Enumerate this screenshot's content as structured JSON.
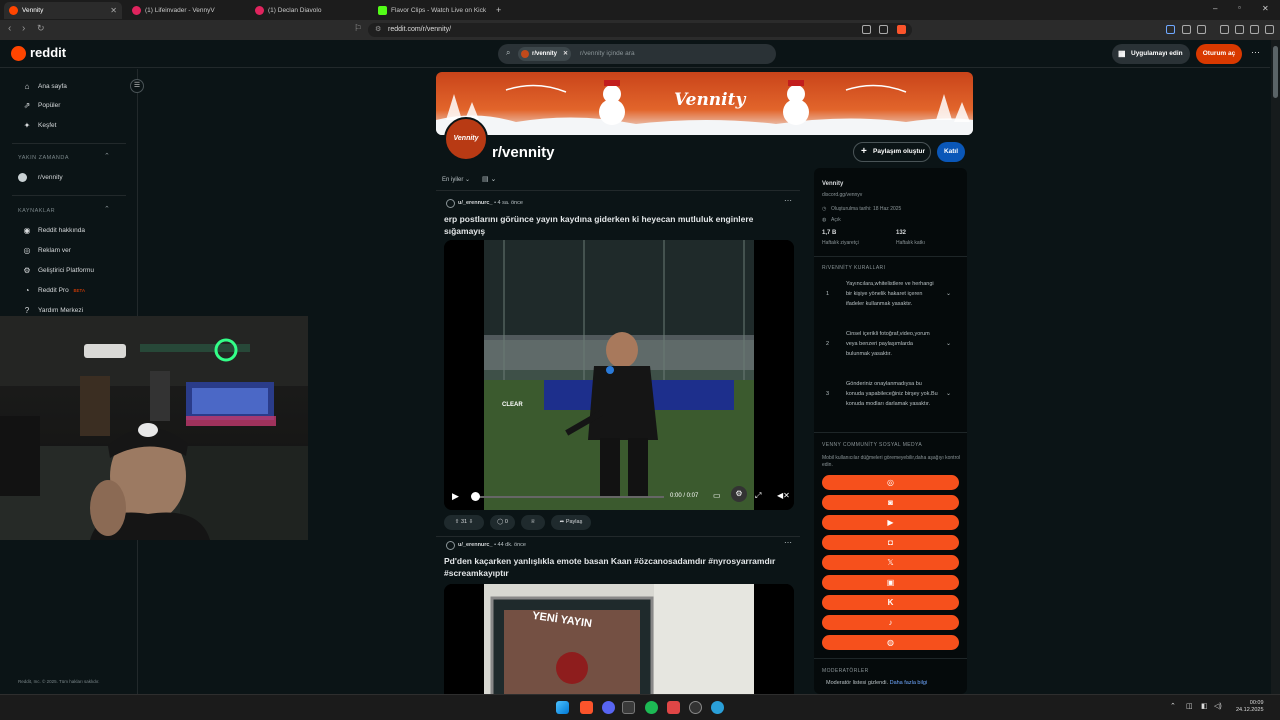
{
  "browser": {
    "tabs": [
      {
        "title": "Vennity",
        "color": "#ff4500"
      },
      {
        "title": "(1) Lifeinvader - VennyV",
        "color": "#e0245e"
      },
      {
        "title": "(1) Declan Diavolo",
        "color": "#e0245e"
      },
      {
        "title": "Flavor Clips - Watch Live on Kick",
        "color": "#53fc18"
      }
    ],
    "new_tab": "+",
    "url": "reddit.com/r/vennity/",
    "window_controls": [
      "–",
      "▫",
      "✕"
    ]
  },
  "header": {
    "logo_text": "reddit",
    "search_chip": "r/vennity",
    "search_placeholder": "r/vennity içinde ara",
    "get_app": "Uygulamayı edin",
    "login": "Oturum aç",
    "more": "⋯"
  },
  "sidebar": {
    "items": [
      {
        "label": "Ana sayfa",
        "icon": "⌂"
      },
      {
        "label": "Popüler",
        "icon": "⇗"
      },
      {
        "label": "Keşfet",
        "icon": "✦"
      }
    ],
    "recent_header": "YAKIN ZAMANDA",
    "recent": [
      {
        "label": "r/vennity"
      }
    ],
    "resources_header": "KAYNAKLAR",
    "resources": [
      {
        "label": "Reddit hakkında",
        "icon": "◉"
      },
      {
        "label": "Reklam ver",
        "icon": "◎"
      },
      {
        "label": "Geliştirici Platformu",
        "icon": "⚙"
      },
      {
        "label": "Reddit Pro",
        "icon": "◔",
        "badge": "BETA"
      },
      {
        "label": "Yardım Merkezi",
        "icon": "?"
      }
    ],
    "footer": "Reddit, Inc. © 2025. Tüm hakları saklıdır."
  },
  "subreddit": {
    "name": "r/vennity",
    "banner_text": "Vennity",
    "icon_text": "Vennity",
    "create_post": "Paylaşım oluştur",
    "join": "Katıl",
    "sort": "En iyiler ⌄",
    "view": "▤ ⌄"
  },
  "posts": [
    {
      "author": "u/_erennurc_",
      "time": "• 4 sa. önce",
      "title": "erp postlarını görünce yayın kaydına giderken ki heyecan mutluluk enginlere sığamayış",
      "video_time": "0:00 / 0:07",
      "video_text": "CLEAR",
      "votes": "31",
      "comments": "0",
      "share": "Paylaş"
    },
    {
      "author": "u/_erennurc_",
      "time": "• 44 dk. önce",
      "title": "Pd'den kaçarken yanlışlıkla emote basan Kaan #özcanosadamdır #nyrosyarramdır #screamkayıptır",
      "image_text": "YENİ YAYIN"
    }
  ],
  "about": {
    "title": "Vennity",
    "link": "discord.gg/vennyv",
    "created": "Oluşturulma tarihi: 18 Haz 2025",
    "visibility": "Açık",
    "stat1_value": "1,7 B",
    "stat1_label": "Haftalık ziyaretçi",
    "stat2_value": "132",
    "stat2_label": "Haftalık katkı",
    "rules_header": "R/VENNİTY KURALLARI",
    "rules": [
      {
        "n": "1",
        "text": "Yayıncılara,whitelistlere ve herhangi bir kişiye yönelik hakaret içeren ifadeler kullanmak yasaktır."
      },
      {
        "n": "2",
        "text": "Cinsel içerikli fotoğraf,video,yorum veya benzeri paylaşımlarda bulunmak yasaktır."
      },
      {
        "n": "3",
        "text": "Gönderiniz onaylanmadıysa bu konuda yapabileceğiniz birşey yok.Bu konuda modları darlamak yasaktır."
      }
    ],
    "social_header": "VENNY COMMUNİTY SOSYAL MEDYA",
    "social_note": "Mobil kullanıcılar düğmeleri göremeyebilir,daha aşağıyı kontrol edin.",
    "social_buttons": [
      {
        "icon": "globe-icon",
        "glyph": "◎"
      },
      {
        "icon": "discord-icon",
        "glyph": "◙"
      },
      {
        "icon": "youtube-icon",
        "glyph": "▶"
      },
      {
        "icon": "instagram-icon",
        "glyph": "◘"
      },
      {
        "icon": "x-icon",
        "glyph": "𝕏"
      },
      {
        "icon": "twitch-icon",
        "glyph": "▣"
      },
      {
        "icon": "kick-icon",
        "glyph": "K"
      },
      {
        "icon": "tiktok-icon",
        "glyph": "♪"
      },
      {
        "icon": "steam-icon",
        "glyph": "◍"
      }
    ],
    "mods_header": "MODERATÖRLER",
    "mods_text": "Moderatör listesi gizlendi.",
    "mods_link": "Daha fazla bilgi"
  },
  "taskbar": {
    "time": "00:09",
    "date": "24.12.2025"
  },
  "colors": {
    "accent": "#ff4500",
    "join": "#0a57b8",
    "social": "#f6501c"
  }
}
